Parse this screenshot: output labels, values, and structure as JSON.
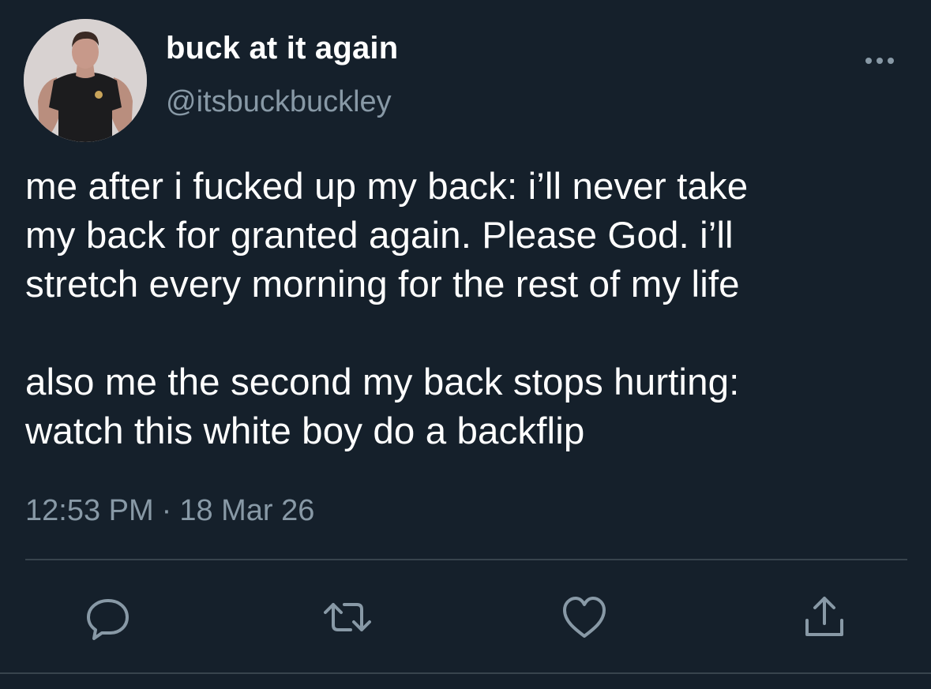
{
  "author": {
    "display_name": "buck at it again",
    "handle": "@itsbuckbuckley"
  },
  "tweet": {
    "text": "me after i fucked up my back: i’ll never take\nmy back for granted again. Please God. i’ll\nstretch every morning for the rest of my life\n\nalso me the second my back stops hurting:\nwatch this white boy do a backflip",
    "time": "12:53 PM",
    "separator": "·",
    "date": "18 Mar 26"
  },
  "icons": {
    "more": "more-horizontal-icon",
    "reply": "reply-icon",
    "retweet": "retweet-icon",
    "like": "like-icon",
    "share": "share-icon"
  },
  "colors": {
    "background": "#15202b",
    "primary_text": "#ffffff",
    "secondary_text": "#8899a6",
    "divider": "#38444d"
  }
}
